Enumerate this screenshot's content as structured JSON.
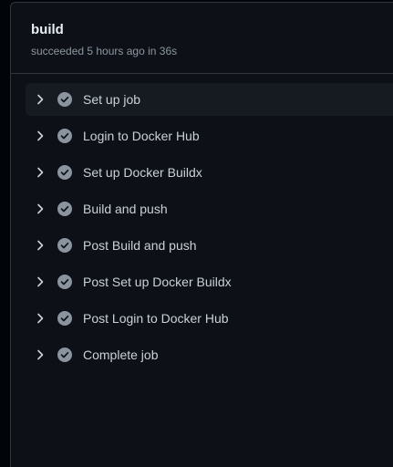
{
  "job": {
    "title": "build",
    "status": "succeeded 5 hours ago in 36s"
  },
  "colors": {
    "page_bg": "#010409",
    "panel_bg": "#0d1117",
    "border": "#30363d",
    "active_row": "#161b22",
    "check_fill": "#8b949e",
    "text": "#c9d1d9"
  },
  "steps": [
    {
      "label": "Set up job",
      "icon": "check-circle-icon",
      "active": true
    },
    {
      "label": "Login to Docker Hub",
      "icon": "check-circle-icon"
    },
    {
      "label": "Set up Docker Buildx",
      "icon": "check-circle-icon"
    },
    {
      "label": "Build and push",
      "icon": "check-circle-icon"
    },
    {
      "label": "Post Build and push",
      "icon": "check-circle-icon"
    },
    {
      "label": "Post Set up Docker Buildx",
      "icon": "check-circle-icon"
    },
    {
      "label": "Post Login to Docker Hub",
      "icon": "check-circle-icon"
    },
    {
      "label": "Complete job",
      "icon": "check-circle-icon"
    }
  ]
}
